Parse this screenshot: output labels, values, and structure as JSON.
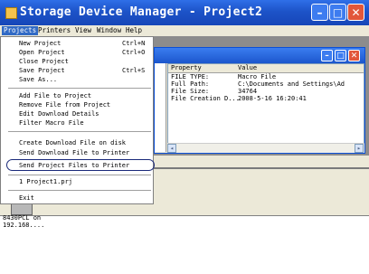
{
  "window": {
    "title": "Storage Device Manager - Project2"
  },
  "menubar": [
    "Projects",
    "Printers",
    "View",
    "Window",
    "Help"
  ],
  "projects_menu": {
    "groups": [
      [
        {
          "label": "New Project",
          "shortcut": "Ctrl+N"
        },
        {
          "label": "Open Project",
          "shortcut": "Ctrl+O"
        },
        {
          "label": "Close Project",
          "shortcut": ""
        },
        {
          "label": "Save Project",
          "shortcut": "Ctrl+S"
        },
        {
          "label": "Save As...",
          "shortcut": ""
        }
      ],
      [
        {
          "label": "Add File to Project",
          "shortcut": ""
        },
        {
          "label": "Remove File from Project",
          "shortcut": ""
        },
        {
          "label": "Edit Download Details",
          "shortcut": ""
        },
        {
          "label": "Filter Macro File",
          "shortcut": ""
        }
      ],
      [
        {
          "label": "Create Download File on disk",
          "shortcut": ""
        },
        {
          "label": "Send Download File to Printer",
          "shortcut": ""
        },
        {
          "label": "Send Project Files to Printer",
          "shortcut": ""
        }
      ],
      [
        {
          "label": "1 Project1.prj",
          "shortcut": ""
        }
      ],
      [
        {
          "label": "Exit",
          "shortcut": ""
        }
      ]
    ],
    "highlighted": "Send Project Files to Printer"
  },
  "properties": {
    "columns": [
      "Property",
      "Value"
    ],
    "rows": [
      [
        "FILE TYPE:",
        "Macro File"
      ],
      [
        "Full Path:",
        "C:\\Documents and Settings\\Ad"
      ],
      [
        "File Size:",
        "34764"
      ],
      [
        "File Creation D...",
        "2008-5-16 16:20:41"
      ]
    ]
  },
  "printer": {
    "label_line1": "8430PCL on",
    "label_line2": "192.168...."
  },
  "colors": {
    "title_bar": "#1d53c8",
    "menu_highlight": "#316ac5",
    "close_button": "#e2573a"
  }
}
